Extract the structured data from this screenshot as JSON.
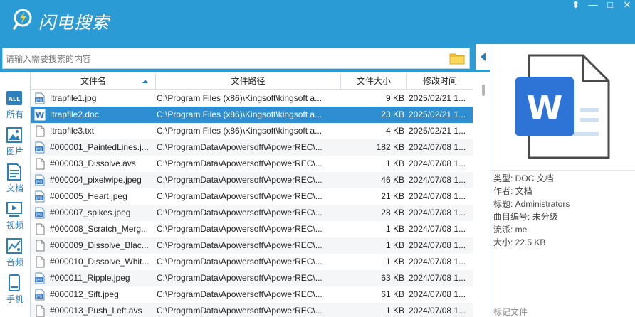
{
  "app": {
    "title": "闪电搜索"
  },
  "window_controls": {
    "pin": "⬍",
    "minimize": "—",
    "maximize": "□",
    "close": "✕"
  },
  "search": {
    "placeholder": "请输入需要搜索的内容",
    "value": ""
  },
  "sidebar": {
    "items": [
      {
        "label": "所有",
        "icon": "all-icon"
      },
      {
        "label": "图片",
        "icon": "image-icon"
      },
      {
        "label": "文档",
        "icon": "document-icon"
      },
      {
        "label": "视频",
        "icon": "video-icon"
      },
      {
        "label": "音频",
        "icon": "audio-icon"
      },
      {
        "label": "手机",
        "icon": "phone-icon"
      }
    ]
  },
  "table": {
    "columns": [
      "文件名",
      "文件路径",
      "文件大小",
      "修改时间"
    ],
    "rows": [
      {
        "icon": "jpg-file-icon",
        "name": "!trapfile1.jpg",
        "path": "C:\\Program Files (x86)\\Kingsoft\\kingsoft a...",
        "size": "9 KB",
        "time": "2025/02/21 1..."
      },
      {
        "icon": "doc-file-icon",
        "name": "!trapfile2.doc",
        "path": "C:\\Program Files (x86)\\Kingsoft\\kingsoft a...",
        "size": "23 KB",
        "time": "2025/02/21 1..."
      },
      {
        "icon": "txt-file-icon",
        "name": "!trapfile3.txt",
        "path": "C:\\Program Files (x86)\\Kingsoft\\kingsoft a...",
        "size": "4 KB",
        "time": "2025/02/21 1..."
      },
      {
        "icon": "jpg-file-icon",
        "name": "#000001_PaintedLines.j...",
        "path": "C:\\ProgramData\\Apowersoft\\ApowerREC\\...",
        "size": "182 KB",
        "time": "2024/07/08 1..."
      },
      {
        "icon": "generic-file-icon",
        "name": "#000003_Dissolve.avs",
        "path": "C:\\ProgramData\\Apowersoft\\ApowerREC\\...",
        "size": "1 KB",
        "time": "2024/07/08 1..."
      },
      {
        "icon": "jpg-file-icon",
        "name": "#000004_pixelwipe.jpeg",
        "path": "C:\\ProgramData\\Apowersoft\\ApowerREC\\...",
        "size": "46 KB",
        "time": "2024/07/08 1..."
      },
      {
        "icon": "jpg-file-icon",
        "name": "#000005_Heart.jpeg",
        "path": "C:\\ProgramData\\Apowersoft\\ApowerREC\\...",
        "size": "21 KB",
        "time": "2024/07/08 1..."
      },
      {
        "icon": "jpg-file-icon",
        "name": "#000007_spikes.jpeg",
        "path": "C:\\ProgramData\\Apowersoft\\ApowerREC\\...",
        "size": "28 KB",
        "time": "2024/07/08 1..."
      },
      {
        "icon": "generic-file-icon",
        "name": "#000008_Scratch_Merg...",
        "path": "C:\\ProgramData\\Apowersoft\\ApowerREC\\...",
        "size": "1 KB",
        "time": "2024/07/08 1..."
      },
      {
        "icon": "generic-file-icon",
        "name": "#000009_Dissolve_Blac...",
        "path": "C:\\ProgramData\\Apowersoft\\ApowerREC\\...",
        "size": "1 KB",
        "time": "2024/07/08 1..."
      },
      {
        "icon": "generic-file-icon",
        "name": "#000010_Dissolve_Whit...",
        "path": "C:\\ProgramData\\Apowersoft\\ApowerREC\\...",
        "size": "1 KB",
        "time": "2024/07/08 1..."
      },
      {
        "icon": "jpg-file-icon",
        "name": "#000011_Ripple.jpeg",
        "path": "C:\\ProgramData\\Apowersoft\\ApowerREC\\...",
        "size": "63 KB",
        "time": "2024/07/08 1..."
      },
      {
        "icon": "jpg-file-icon",
        "name": "#000012_Sift.jpeg",
        "path": "C:\\ProgramData\\Apowersoft\\ApowerREC\\...",
        "size": "61 KB",
        "time": "2024/07/08 1..."
      },
      {
        "icon": "generic-file-icon",
        "name": "#000013_Push_Left.avs",
        "path": "C:\\ProgramData\\Apowersoft\\ApowerREC\\...",
        "size": "1 KB",
        "time": "2024/07/08 1..."
      }
    ],
    "selected_index": 1
  },
  "details": {
    "preview_icon": "word-document-icon",
    "lines": [
      "类型:  DOC 文档",
      "作者:  文档",
      "标题:  Administrators",
      "曲目编号:  未分级",
      "流派:  me",
      "大小:  22.5 KB"
    ],
    "mark_label": "标记文件"
  },
  "colors": {
    "accent": "#2b9bd6",
    "selection": "#2d8ed2",
    "side_icon": "#2b7fba"
  }
}
